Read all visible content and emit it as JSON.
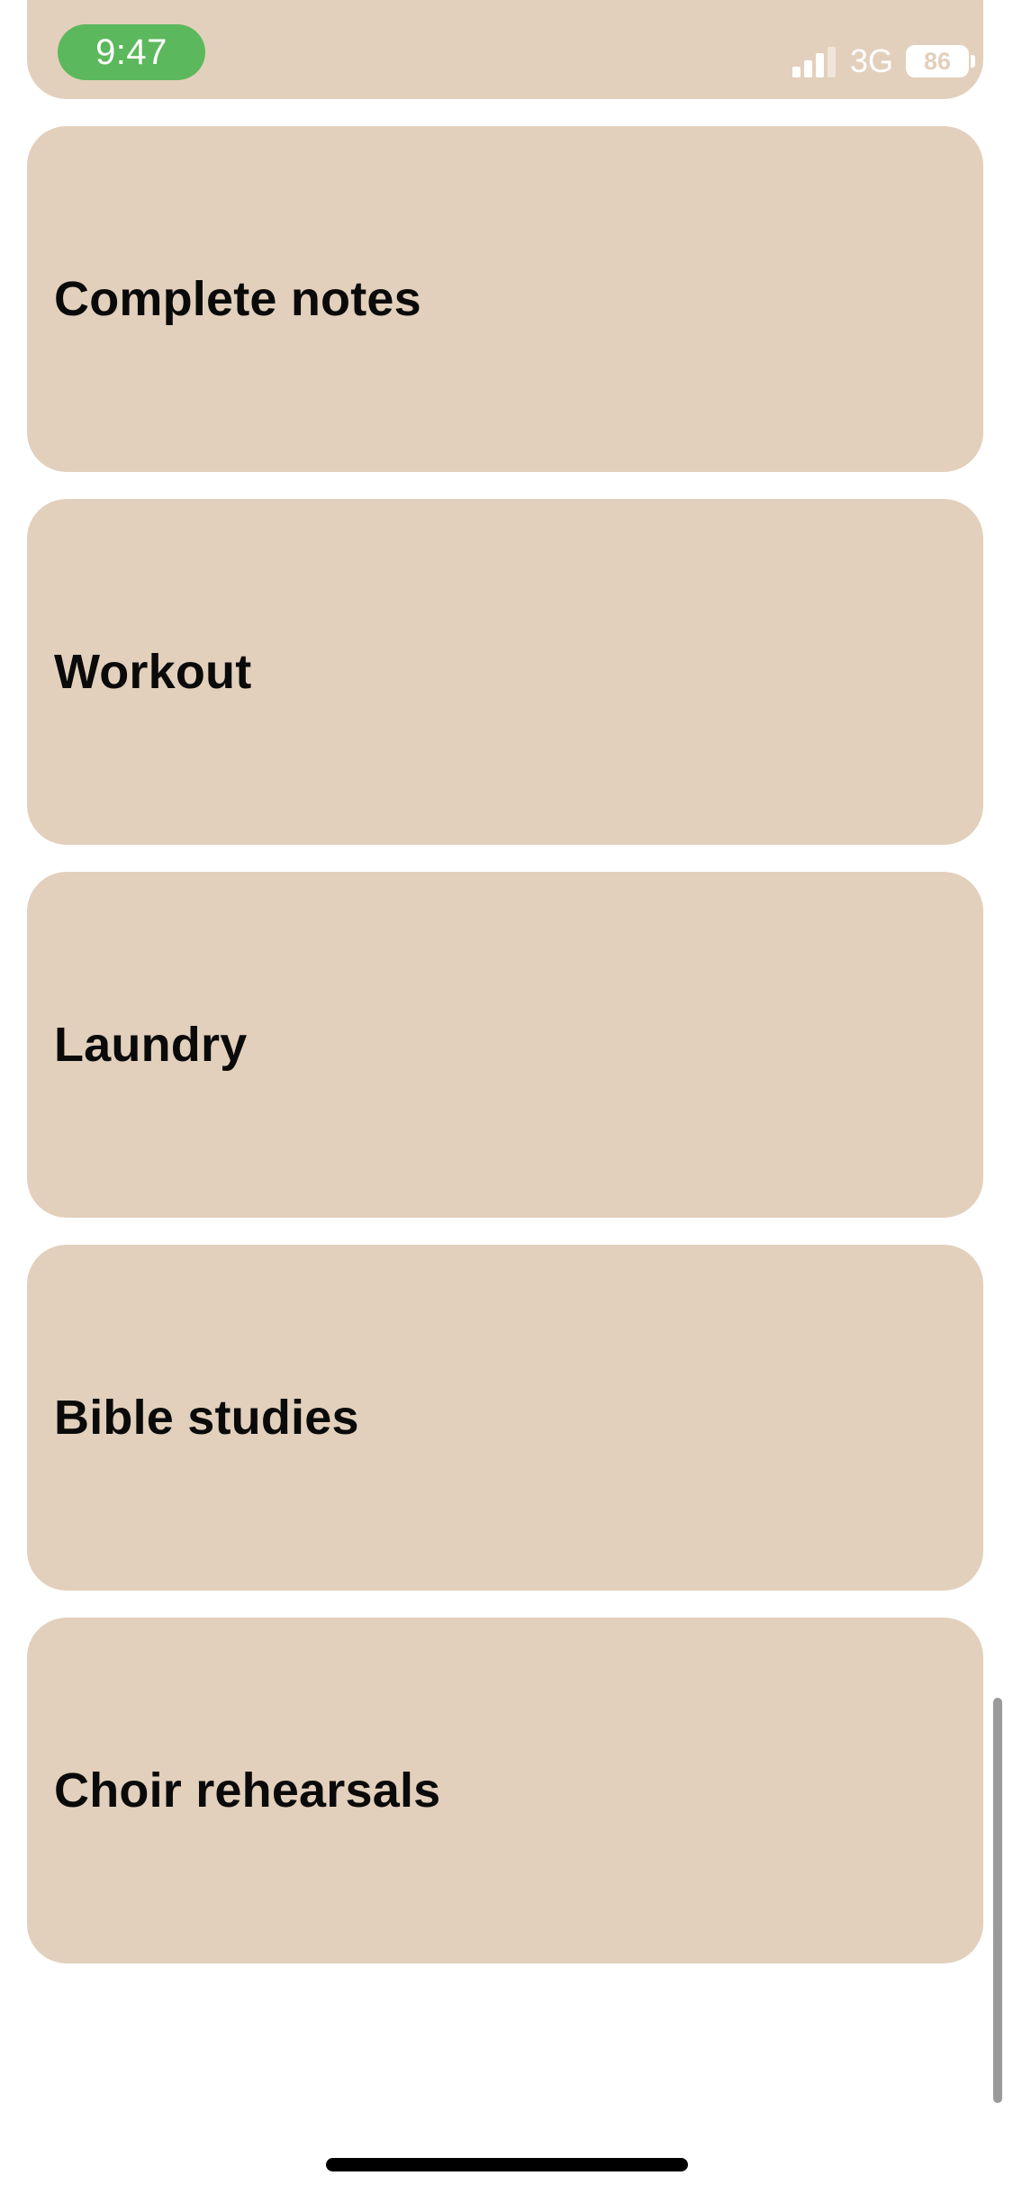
{
  "status_bar": {
    "time": "9:47",
    "network": "3G",
    "battery": "86",
    "icons": [
      "signal-icon",
      "battery-icon"
    ]
  },
  "tasks": [
    {
      "title": "Complete notes"
    },
    {
      "title": "Workout"
    },
    {
      "title": "Laundry"
    },
    {
      "title": "Bible studies"
    },
    {
      "title": "Choir rehearsals"
    }
  ],
  "colors": {
    "card": "#e2d0bc",
    "time_pill": "#5cb85c",
    "text": "#0a0a0a",
    "background": "#ffffff"
  }
}
